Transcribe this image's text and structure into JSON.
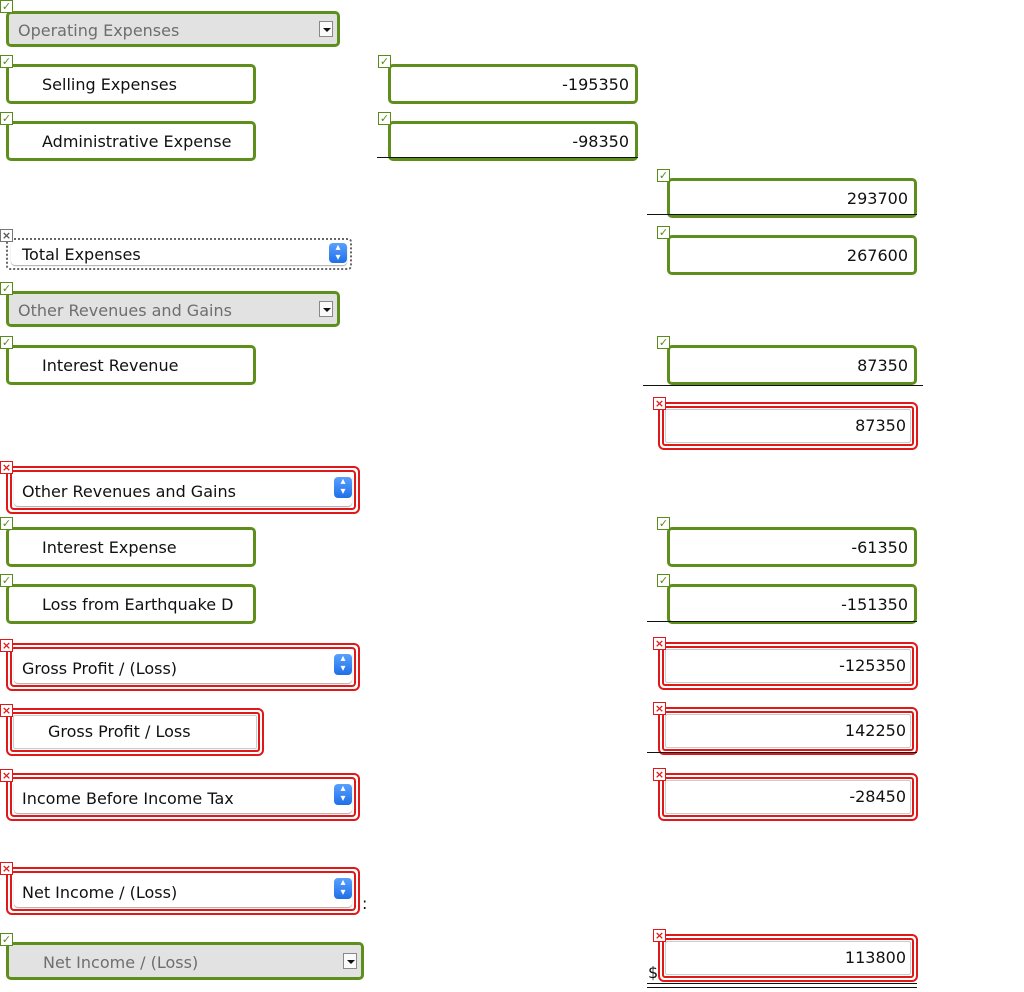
{
  "rows": {
    "operating_expenses": {
      "label": "Operating Expenses",
      "status": "correct",
      "type": "select-disabled"
    },
    "selling_expenses": {
      "label": "Selling Expenses",
      "value": "-195350",
      "label_status": "correct",
      "value_status": "correct"
    },
    "administrative_expense": {
      "label": "Administrative Expense",
      "value": "-98350",
      "label_status": "correct",
      "value_status": "correct"
    },
    "subtotal_expenses": {
      "value": "293700",
      "status": "correct"
    },
    "total_expenses": {
      "label": "Total Expenses",
      "value": "267600",
      "label_status": "unanswered",
      "value_status": "correct"
    },
    "other_revenues_header": {
      "label": "Other Revenues and Gains",
      "status": "correct"
    },
    "interest_revenue": {
      "label": "Interest Revenue",
      "value": "87350",
      "label_status": "correct",
      "value_status": "correct"
    },
    "other_revenues_total": {
      "value": "87350",
      "status": "incorrect"
    },
    "other_revenues_select": {
      "label": "Other Revenues and Gains",
      "status": "incorrect"
    },
    "interest_expense": {
      "label": "Interest Expense",
      "value": "-61350",
      "label_status": "correct",
      "value_status": "correct"
    },
    "loss_from_earthquake": {
      "label": "Loss from Earthquake D",
      "value": "-151350",
      "label_status": "correct",
      "value_status": "correct"
    },
    "gross_profit_select": {
      "label": "Gross Profit / (Loss)",
      "value": "-125350",
      "label_status": "incorrect",
      "value_status": "incorrect"
    },
    "gross_profit_text": {
      "label": "Gross Profit / Loss",
      "value": "142250",
      "label_status": "incorrect",
      "value_status": "incorrect"
    },
    "income_before_tax": {
      "label": "Income Before Income Tax",
      "value": "-28450",
      "label_status": "incorrect",
      "value_status": "incorrect"
    },
    "net_income_select": {
      "label": "Net Income / (Loss)",
      "suffix": ":",
      "status": "incorrect"
    },
    "net_income_final": {
      "label": "Net Income / (Loss)",
      "currency": "$",
      "value": "113800",
      "label_status": "correct",
      "value_status": "incorrect"
    }
  },
  "icons": {
    "correct": "✓",
    "incorrect": "×",
    "unanswered": "×",
    "stepper": "⌃⌄"
  },
  "colors": {
    "correct": "#5e8f1c",
    "incorrect": "#e01818",
    "mac_blue": "#1e6fe8"
  }
}
